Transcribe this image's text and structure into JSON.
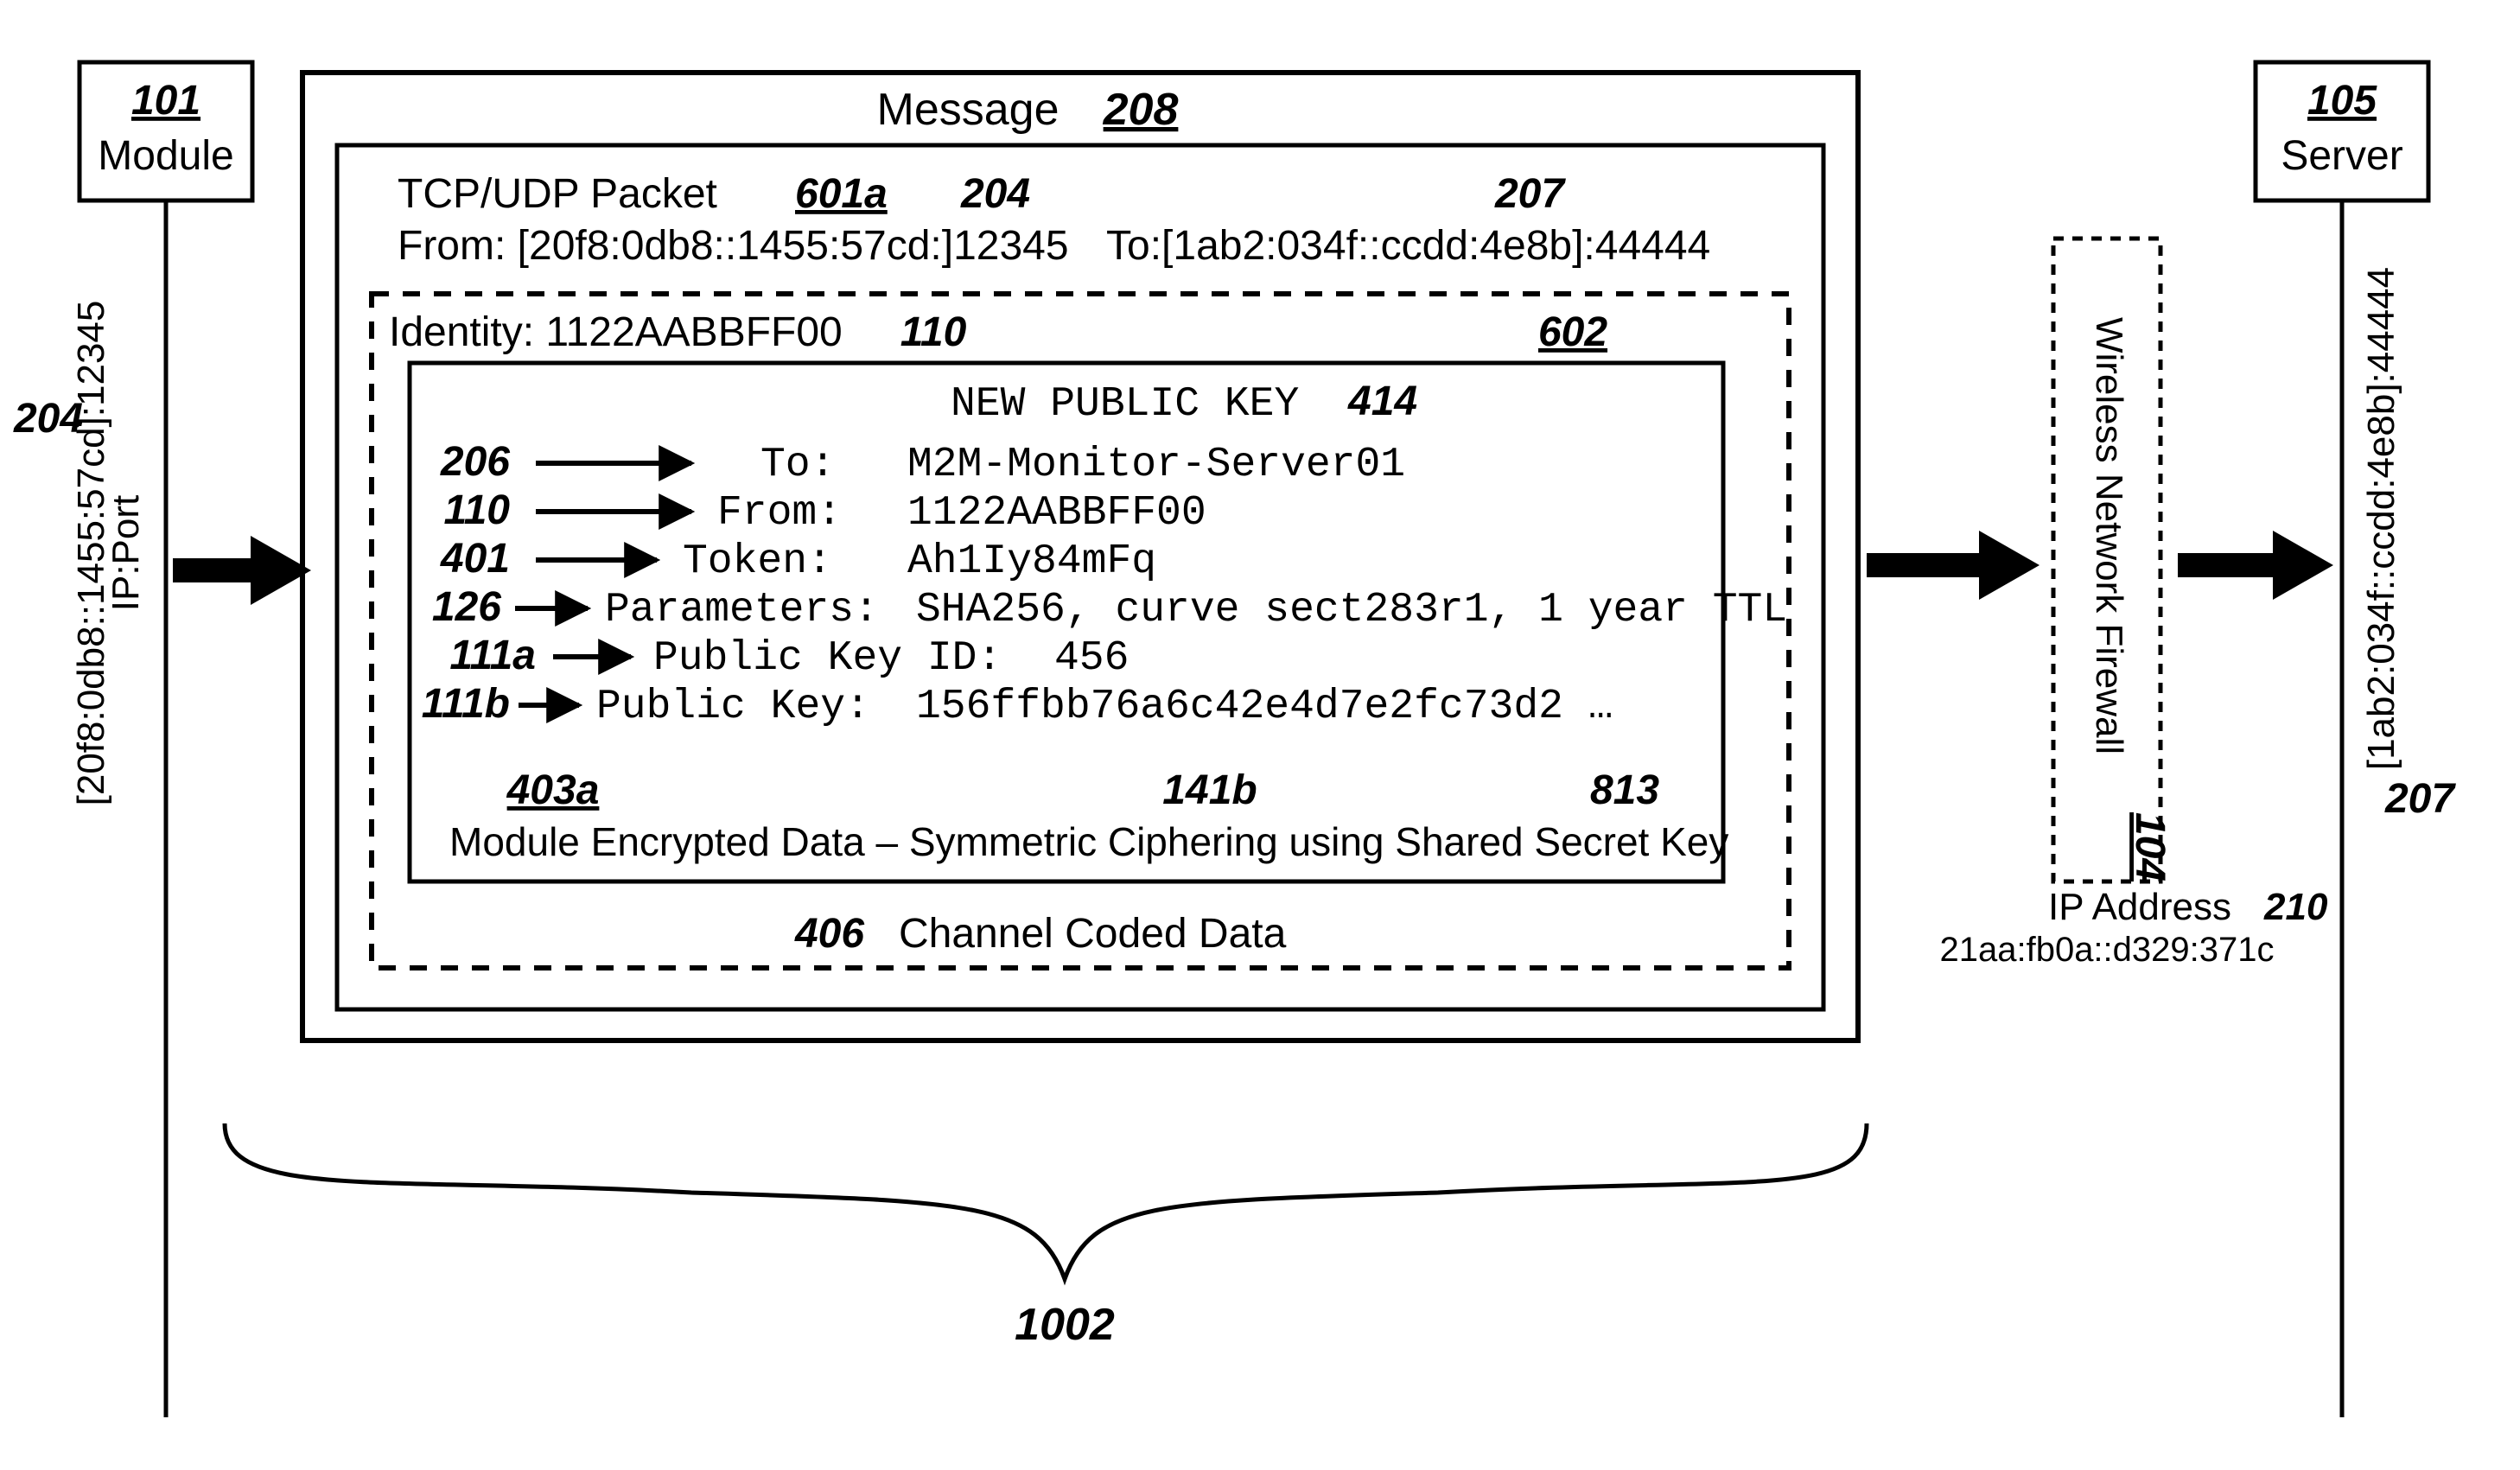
{
  "module": {
    "ref": "101",
    "label": "Module"
  },
  "server": {
    "ref": "105",
    "label": "Server"
  },
  "module_ipport": {
    "label": "IP:Port",
    "value": "[20f8:0db8::1455:57cd]:12345",
    "ref": "204"
  },
  "server_ipport": {
    "value": "[1ab2:034f::ccdd:4e8b]:44444",
    "ref": "207"
  },
  "message": {
    "title": "Message",
    "ref": "208"
  },
  "packet": {
    "title": "TCP/UDP Packet",
    "ref": "601a",
    "from": {
      "label": "From: [20f8:0db8::1455:57cd:]12345",
      "ref": "204"
    },
    "to": {
      "label": "To:[1ab2:034f::ccdd:4e8b]:44444",
      "ref": "207"
    }
  },
  "identity": {
    "label": "Identity: 1122AABBFF00",
    "ref": "110",
    "box_ref": "602"
  },
  "key": {
    "title": "NEW PUBLIC KEY",
    "title_ref": "414",
    "lines": [
      {
        "ref": "206",
        "k": "To:",
        "v": "M2M-Monitor-Server01"
      },
      {
        "ref": "110",
        "k": "From:",
        "v": "1122AABBFF00"
      },
      {
        "ref": "401",
        "k": "Token:",
        "v": "Ah1Iy84mFq"
      },
      {
        "ref": "126",
        "k": "Parameters:",
        "v": "SHA256, curve sect283r1, 1 year TTL"
      },
      {
        "ref": "111a",
        "k": "Public Key ID:",
        "v": "456"
      },
      {
        "ref": "111b",
        "k": "Public Key:",
        "v": "156ffbb76a6c42e4d7e2fc73d2 …"
      }
    ],
    "enc": {
      "ref": "403a",
      "midref": "141b",
      "rightref": "813",
      "text": "Module Encrypted Data – Symmetric Ciphering using Shared Secret Key"
    }
  },
  "channel": {
    "ref": "406",
    "text": "Channel Coded Data"
  },
  "firewall": {
    "label": "Wireless Network Firewall",
    "ref": "104",
    "ip_label": "IP Address",
    "ip_ref": "210",
    "ip_value": "21aa:fb0a::d329:371c"
  },
  "brace_ref": "1002"
}
